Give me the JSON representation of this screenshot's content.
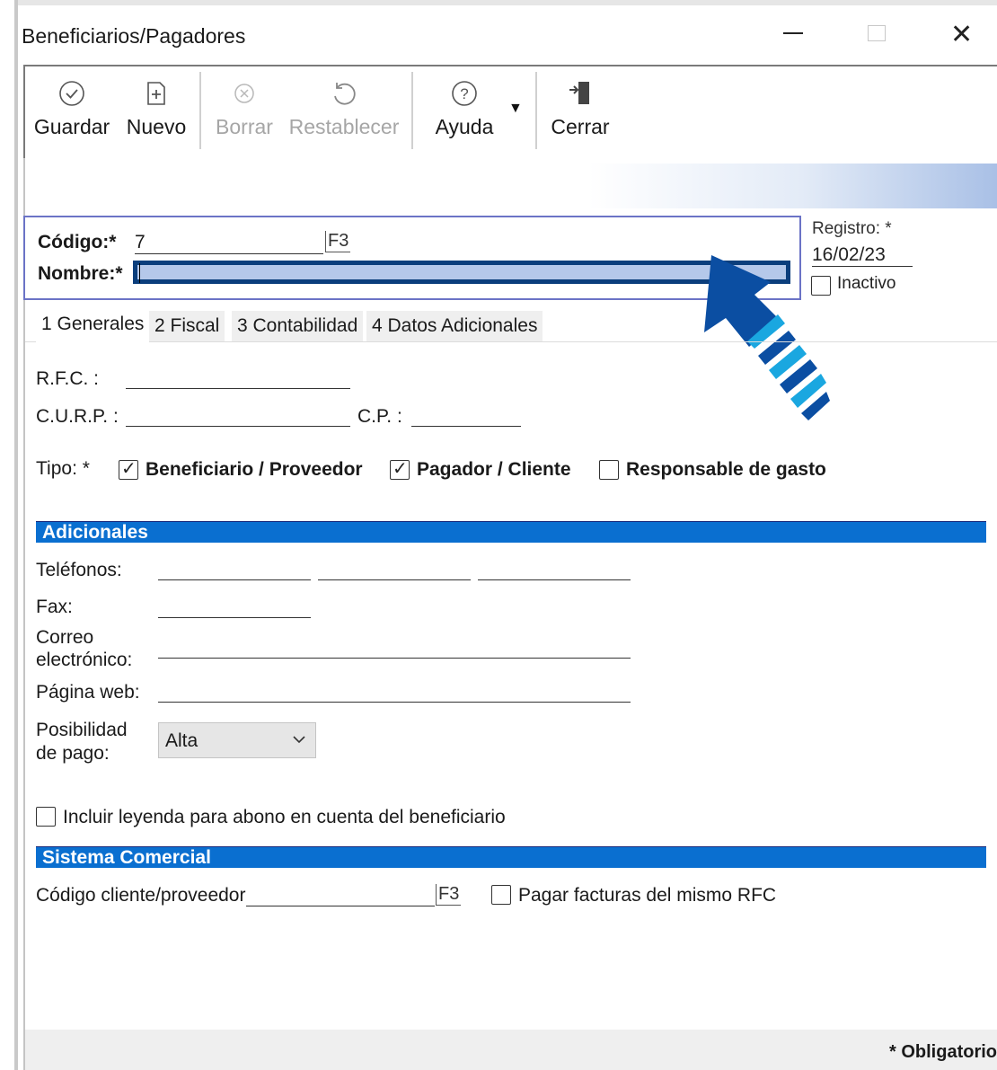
{
  "window": {
    "title": "Beneficiarios/Pagadores",
    "minimize_icon": "minimize-icon",
    "maximize_icon": "maximize-icon",
    "close_glyph": "✕"
  },
  "toolbar": {
    "guardar": "Guardar",
    "nuevo": "Nuevo",
    "borrar": "Borrar",
    "restablecer": "Restablecer",
    "ayuda": "Ayuda",
    "cerrar": "Cerrar",
    "icons": {
      "guardar": "✓",
      "nuevo": "+",
      "borrar": "⊗",
      "restablecer": "↺",
      "ayuda": "?",
      "cerrar": "exit-door-icon",
      "dropdown": "▼"
    }
  },
  "header": {
    "codigo_label": "Código:*",
    "codigo_value": "7",
    "codigo_f3": "F3",
    "nombre_label": "Nombre:*",
    "nombre_value": "",
    "registro_label": "Registro: *",
    "registro_value": "16/02/23",
    "inactivo_label": "Inactivo",
    "inactivo_checked": false
  },
  "tabs": [
    {
      "label": "1 Generales",
      "active": true
    },
    {
      "label": "2 Fiscal",
      "active": false
    },
    {
      "label": "3 Contabilidad",
      "active": false
    },
    {
      "label": "4 Datos Adicionales",
      "active": false
    }
  ],
  "generales": {
    "rfc_label": "R.F.C. :",
    "curp_label": "C.U.R.P. :",
    "cp_label": "C.P. :",
    "tipo_label": "Tipo: *",
    "tipo_options": [
      {
        "label": "Beneficiario / Proveedor",
        "checked": true
      },
      {
        "label": "Pagador / Cliente",
        "checked": true
      },
      {
        "label": "Responsable de gasto",
        "checked": false
      }
    ]
  },
  "adicionales": {
    "section_title": "Adicionales",
    "telefonos_label": "Teléfonos:",
    "fax_label": "Fax:",
    "correo_label_1": "Correo",
    "correo_label_2": "electrónico:",
    "pagina_label": "Página web:",
    "posibilidad_label_1": "Posibilidad",
    "posibilidad_label_2": "de pago:",
    "posibilidad_value": "Alta",
    "leyenda_label": "Incluir leyenda para abono en cuenta del beneficiario",
    "leyenda_checked": false
  },
  "sistema_comercial": {
    "section_title": "Sistema Comercial",
    "codigo_label": "Código cliente/proveedor",
    "codigo_f3": "F3",
    "pagar_label": "Pagar facturas del mismo RFC",
    "pagar_checked": false
  },
  "footer": {
    "obligatorio": "* Obligatorio"
  },
  "colors": {
    "section_blue": "#0a6fd0",
    "highlight_field": "#b5c8ea",
    "focus_border": "#0b3e7c",
    "arrow_blue": "#0b4ea2",
    "arrow_cyan": "#1aa7e0"
  }
}
